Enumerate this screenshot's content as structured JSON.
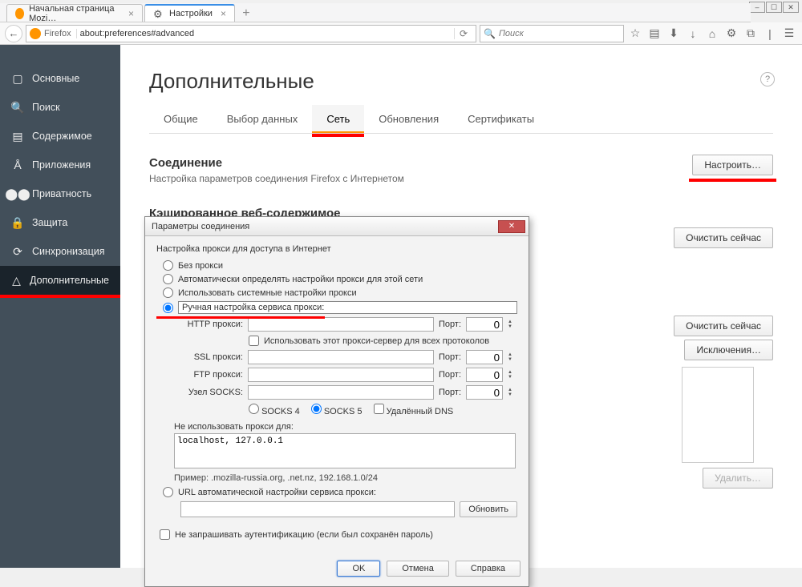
{
  "window": {
    "controls": {
      "min": "–",
      "max": "☐",
      "close": "✕"
    }
  },
  "tabs": [
    {
      "label": "Начальная страница Mozi…",
      "favicon": "firefox"
    },
    {
      "label": "Настройки",
      "favicon": "gear"
    }
  ],
  "newtab": "+",
  "nav": {
    "back": "←",
    "fflabel": "Firefox"
  },
  "url": "about:preferences#advanced",
  "search_placeholder": "Поиск",
  "toolbar_icons": [
    "☆",
    "▤",
    "⬇",
    "↓",
    "⌂",
    "⚙",
    "⧉",
    "|",
    "☰"
  ],
  "sidebar": [
    {
      "icon": "▢",
      "label": "Основные"
    },
    {
      "icon": "🔍",
      "label": "Поиск"
    },
    {
      "icon": "▤",
      "label": "Содержимое"
    },
    {
      "icon": "Å",
      "label": "Приложения"
    },
    {
      "icon": "⬤⬤",
      "label": "Приватность"
    },
    {
      "icon": "🔒",
      "label": "Защита"
    },
    {
      "icon": "⟳",
      "label": "Синхронизация"
    },
    {
      "icon": "△",
      "label": "Дополнительные"
    }
  ],
  "page": {
    "title": "Дополнительные",
    "help": "?",
    "subtabs": [
      "Общие",
      "Выбор данных",
      "Сеть",
      "Обновления",
      "Сертификаты"
    ],
    "active_subtab": 2,
    "connection": {
      "title": "Соединение",
      "desc": "Настройка параметров соединения Firefox с Интернетом",
      "btn": "Настроить…"
    },
    "cache": {
      "title": "Кэшированное веб-содержимое"
    },
    "buttons": {
      "clear_now": "Очистить сейчас",
      "exceptions": "Исключения…",
      "delete": "Удалить…"
    }
  },
  "dialog": {
    "title": "Параметры соединения",
    "group": "Настройка прокси для доступа в Интернет",
    "radios": {
      "none": "Без прокси",
      "auto": "Автоматически определять настройки прокси для этой сети",
      "system": "Использовать системные настройки прокси",
      "manual": "Ручная настройка сервиса прокси:"
    },
    "labels": {
      "http": "HTTP прокси:",
      "ssl": "SSL прокси:",
      "ftp": "FTP прокси:",
      "socks": "Узел SOCKS:",
      "port": "Порт:",
      "use_all": "Использовать этот прокси-сервер для всех протоколов",
      "socks4": "SOCKS 4",
      "socks5": "SOCKS 5",
      "remote_dns": "Удалённый DNS",
      "noproxy": "Не использовать прокси для:",
      "example": "Пример: .mozilla-russia.org, .net.nz, 192.168.1.0/24",
      "pac": "URL автоматической настройки сервиса прокси:",
      "reload": "Обновить",
      "auth": "Не запрашивать аутентификацию (если был сохранён пароль)"
    },
    "values": {
      "http": "",
      "ssl": "",
      "ftp": "",
      "socks": "",
      "http_port": "0",
      "ssl_port": "0",
      "ftp_port": "0",
      "socks_port": "0",
      "noproxy": "localhost, 127.0.0.1",
      "pac": ""
    },
    "buttons": {
      "ok": "OK",
      "cancel": "Отмена",
      "help": "Справка"
    }
  }
}
